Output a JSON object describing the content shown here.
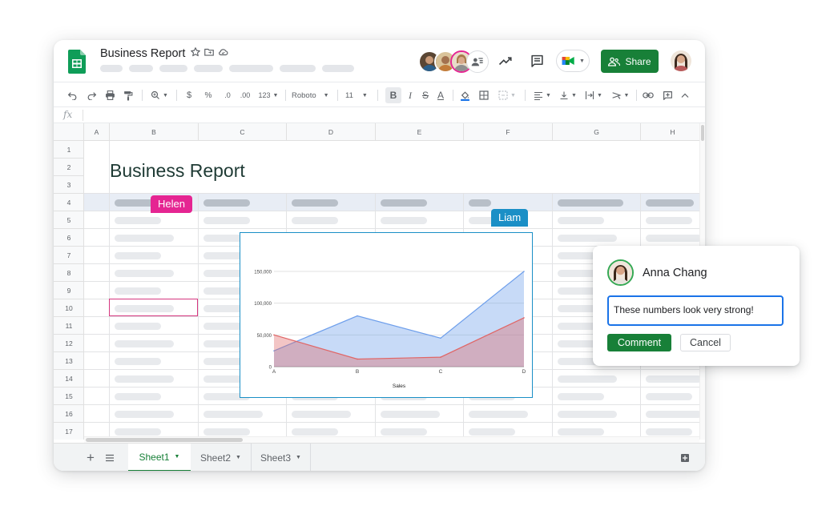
{
  "app": {
    "doc_title": "Business Report",
    "share_label": "Share"
  },
  "toolbar": {
    "zoom_icon": "zoom-icon",
    "currency_label": "$",
    "percent_label": "%",
    "decimal_decrease_label": ".0",
    "decimal_increase_label": ".00",
    "number_format_label": "123",
    "font_family_label": "Roboto",
    "font_size_label": "11",
    "bold_label": "B",
    "italic_label": "I",
    "strike_label": "S",
    "text_color_label": "A"
  },
  "formula_bar": {
    "fx_label": "fx"
  },
  "grid": {
    "columns": [
      "A",
      "B",
      "C",
      "D",
      "E",
      "F",
      "G",
      "H"
    ],
    "rows": [
      "1",
      "2",
      "3",
      "4",
      "5",
      "6",
      "7",
      "8",
      "9",
      "10",
      "11",
      "12",
      "13",
      "14",
      "15",
      "16",
      "17"
    ],
    "heading": "Business Report"
  },
  "collaborators": {
    "helen": "Helen",
    "liam": "Liam"
  },
  "chart_data": {
    "type": "area",
    "categories": [
      "A",
      "B",
      "C",
      "D"
    ],
    "series": [
      {
        "values": [
          25000,
          80000,
          45000,
          150000
        ],
        "color": "#6d9eeb"
      },
      {
        "values": [
          50000,
          12000,
          15000,
          77000
        ],
        "color": "#e06666"
      }
    ],
    "xlabel": "Sales",
    "ylabel": "",
    "ylim": [
      0,
      150000
    ],
    "yticks": [
      "0",
      "50,000",
      "100,000",
      "150,000"
    ],
    "grid": true,
    "legend": "none"
  },
  "sheet_tabs": {
    "tabs": [
      {
        "label": "Sheet1",
        "active": true
      },
      {
        "label": "Sheet2",
        "active": false
      },
      {
        "label": "Sheet3",
        "active": false
      }
    ]
  },
  "comment": {
    "author": "Anna Chang",
    "text": "These numbers look very strong!",
    "submit_label": "Comment",
    "cancel_label": "Cancel"
  },
  "colors": {
    "brand_green": "#188038",
    "helen_color": "#e52592",
    "liam_color": "#1a8fc6",
    "focus_blue": "#1a73e8"
  }
}
